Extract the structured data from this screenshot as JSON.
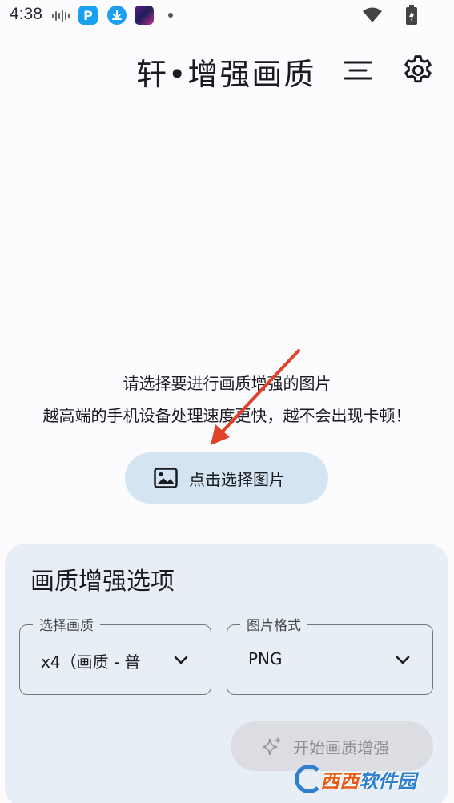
{
  "status_bar": {
    "time": "4:38",
    "icons": [
      "voice-wave-icon",
      "p-app-icon",
      "download-icon",
      "game-thumbnail-icon",
      "notification-dot-icon",
      "wifi-icon",
      "battery-icon"
    ]
  },
  "header": {
    "title": "轩•增强画质",
    "menu_icon": "menu-lines-icon",
    "settings_icon": "gear-icon"
  },
  "main": {
    "hint_line1": "请选择要进行画质增强的图片",
    "hint_line2": "越高端的手机设备处理速度更快，越不会出现卡顿！",
    "select_button_label": "点击选择图片",
    "select_button_icon": "image-icon"
  },
  "options": {
    "title": "画质增强选项",
    "quality": {
      "label": "选择画质",
      "value": "x4（画质 - 普"
    },
    "format": {
      "label": "图片格式",
      "value": "PNG"
    },
    "start_button_label": "开始画质增强",
    "start_button_icon": "sparkle-icon"
  },
  "watermark": {
    "text1": "西西",
    "text2": "软件园"
  },
  "colors": {
    "background": "#fcfbfe",
    "select_button_bg": "#d5e4f3",
    "card_bg": "#e8eef5",
    "disabled_button_bg": "#dcdde2",
    "annotation_arrow": "#e0422a"
  }
}
